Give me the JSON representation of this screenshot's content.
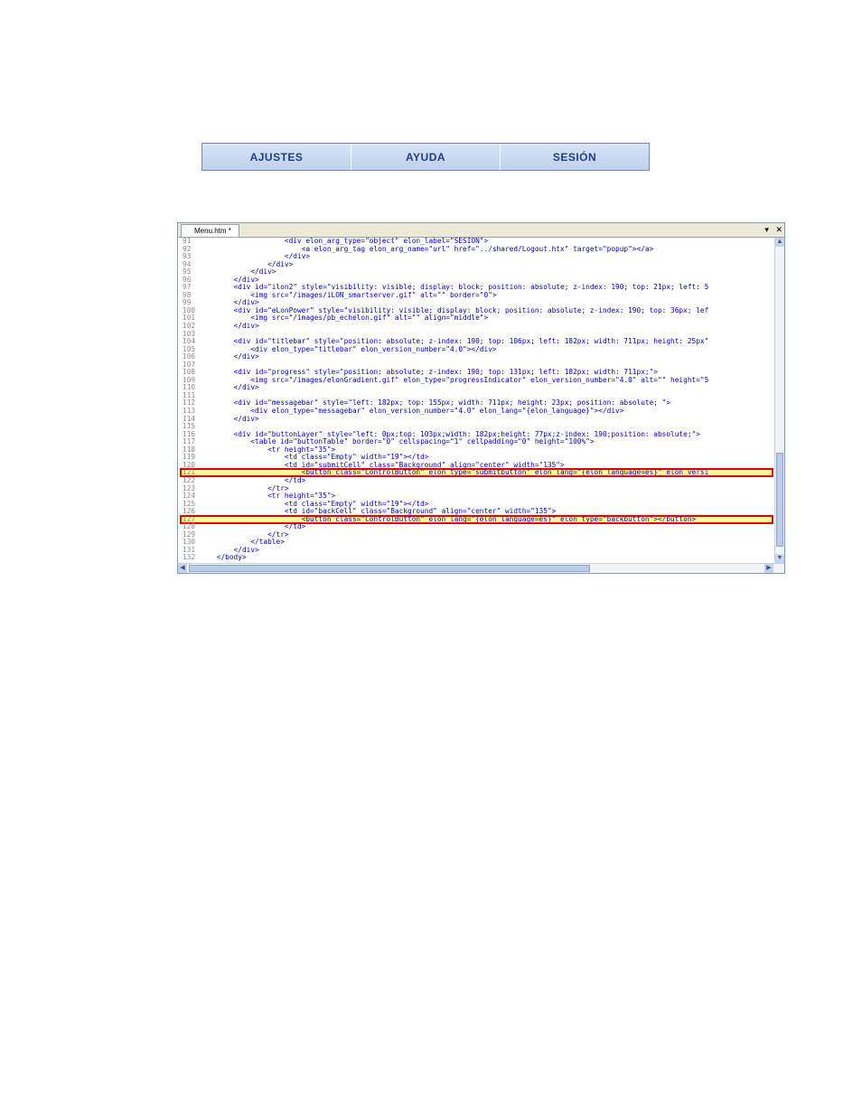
{
  "menu": {
    "items": [
      {
        "label": "AJUSTES"
      },
      {
        "label": "AYUDA"
      },
      {
        "label": "SESIÓN"
      }
    ]
  },
  "editor": {
    "tab_label": "Menu.htm *",
    "dropdown_glyph": "▾",
    "close_glyph": "✕",
    "scroll_up": "▲",
    "scroll_down": "▼",
    "scroll_left": "◀",
    "scroll_right": "▶",
    "highlighted_lines": [
      "121",
      "127"
    ],
    "highlight_color": "#ffff99",
    "highlight_border": "#e00000",
    "lines": [
      {
        "num": "91",
        "text": "                    <div elon_arg_type=\"object\" elon_label=\"SESIÓN\">"
      },
      {
        "num": "92",
        "text": "                        <a elon_arg_tag elon_arg_name=\"url\" href=\"../shared/Logout.htx\" target=\"popup\"></a>"
      },
      {
        "num": "93",
        "text": "                    </div>"
      },
      {
        "num": "94",
        "text": "                </div>"
      },
      {
        "num": "95",
        "text": "            </div>"
      },
      {
        "num": "96",
        "text": "        </div>"
      },
      {
        "num": "97",
        "text": "        <div id=\"ilon2\" style=\"visibility: visible; display: block; position: absolute; z-index: 190; top: 21px; left: 5"
      },
      {
        "num": "98",
        "text": "            <img src=\"/images/iLON_smartserver.gif\" alt=\"\" border=\"0\">"
      },
      {
        "num": "99",
        "text": "        </div>"
      },
      {
        "num": "100",
        "text": "        <div id=\"eLonPower\" style=\"visibility: visible; display: block; position: absolute; z-index: 190; top: 36px; lef"
      },
      {
        "num": "101",
        "text": "            <img src=\"/images/pb_echelon.gif\" alt=\"\" align=\"middle\">"
      },
      {
        "num": "102",
        "text": "        </div>"
      },
      {
        "num": "103",
        "text": ""
      },
      {
        "num": "104",
        "text": "        <div id=\"titlebar\" style=\"position: absolute; z-index: 190; top: 106px; left: 182px; width: 711px; height: 25px\""
      },
      {
        "num": "105",
        "text": "            <div elon_type=\"titlebar\" elon_version_number=\"4.0\"></div>"
      },
      {
        "num": "106",
        "text": "        </div>"
      },
      {
        "num": "107",
        "text": ""
      },
      {
        "num": "108",
        "text": "        <div id=\"progress\" style=\"position: absolute; z-index: 190; top: 131px; left: 182px; width: 711px;\">"
      },
      {
        "num": "109",
        "text": "            <img src=\"/images/elonGradient.gif\" elon_type=\"progressIndicator\" elon_version_number=\"4.0\" alt=\"\" height=\"5"
      },
      {
        "num": "110",
        "text": "        </div>"
      },
      {
        "num": "111",
        "text": ""
      },
      {
        "num": "112",
        "text": "        <div id=\"messagebar\" style=\"left: 182px; top: 155px; width: 711px; height: 23px; position: absolute; \">"
      },
      {
        "num": "113",
        "text": "            <div elon_type=\"messagebar\" elon_version_number=\"4.0\" elon_lang=\"{elon_language}\"></div>"
      },
      {
        "num": "114",
        "text": "        </div>"
      },
      {
        "num": "115",
        "text": ""
      },
      {
        "num": "116",
        "text": "        <div id=\"buttonLayer\" style=\"left: 0px;top: 103px;width: 182px;height: 77px;z-index: 190;position: absolute;\">"
      },
      {
        "num": "117",
        "text": "            <table id=\"buttonTable\" border=\"0\" cellspacing=\"1\" cellpadding=\"0\" height=\"100%\">"
      },
      {
        "num": "118",
        "text": "                <tr height=\"35\">"
      },
      {
        "num": "119",
        "text": "                    <td class=\"Empty\" width=\"19\"></td>"
      },
      {
        "num": "120",
        "text": "                    <td id=\"submitCell\" class=\"Background\" align=\"center\" width=\"135\">"
      },
      {
        "num": "121",
        "text": "                        <button class=\"ControlButton\" elon_type=\"submitbutton\" elon_lang=\"{elon_language=es}\" elon_versi"
      },
      {
        "num": "122",
        "text": "                    </td>"
      },
      {
        "num": "123",
        "text": "                </tr>"
      },
      {
        "num": "124",
        "text": "                <tr height=\"35\">"
      },
      {
        "num": "125",
        "text": "                    <td class=\"Empty\" width=\"19\"></td>"
      },
      {
        "num": "126",
        "text": "                    <td id=\"backCell\" class=\"Background\" align=\"center\" width=\"135\">"
      },
      {
        "num": "127",
        "text": "                        <button class=\"ControlButton\" elon_lang=\"{elon_language=es}\" elon_type=\"backbutton\"></button>"
      },
      {
        "num": "128",
        "text": "                    </td>"
      },
      {
        "num": "129",
        "text": "                </tr>"
      },
      {
        "num": "130",
        "text": "            </table>"
      },
      {
        "num": "131",
        "text": "        </div>"
      },
      {
        "num": "132",
        "text": "    </body>"
      }
    ]
  }
}
